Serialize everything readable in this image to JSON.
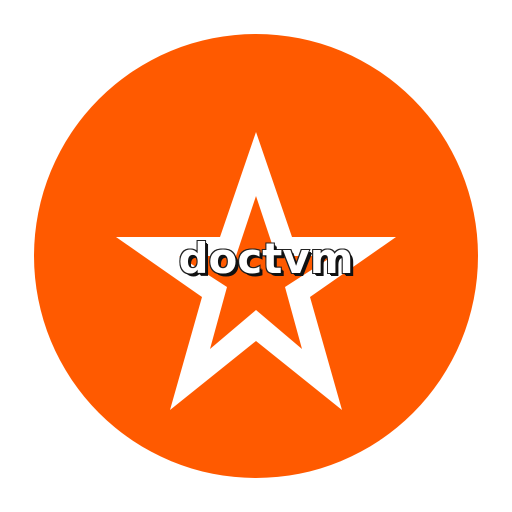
{
  "icon": {
    "brand_name": "doctvm",
    "symbol": "star-icon",
    "colors": {
      "background": "#ffffff",
      "circle": "#ff5a00",
      "star": "#ffffff",
      "text_fill": "#ffffff",
      "text_outline": "#111111"
    }
  }
}
